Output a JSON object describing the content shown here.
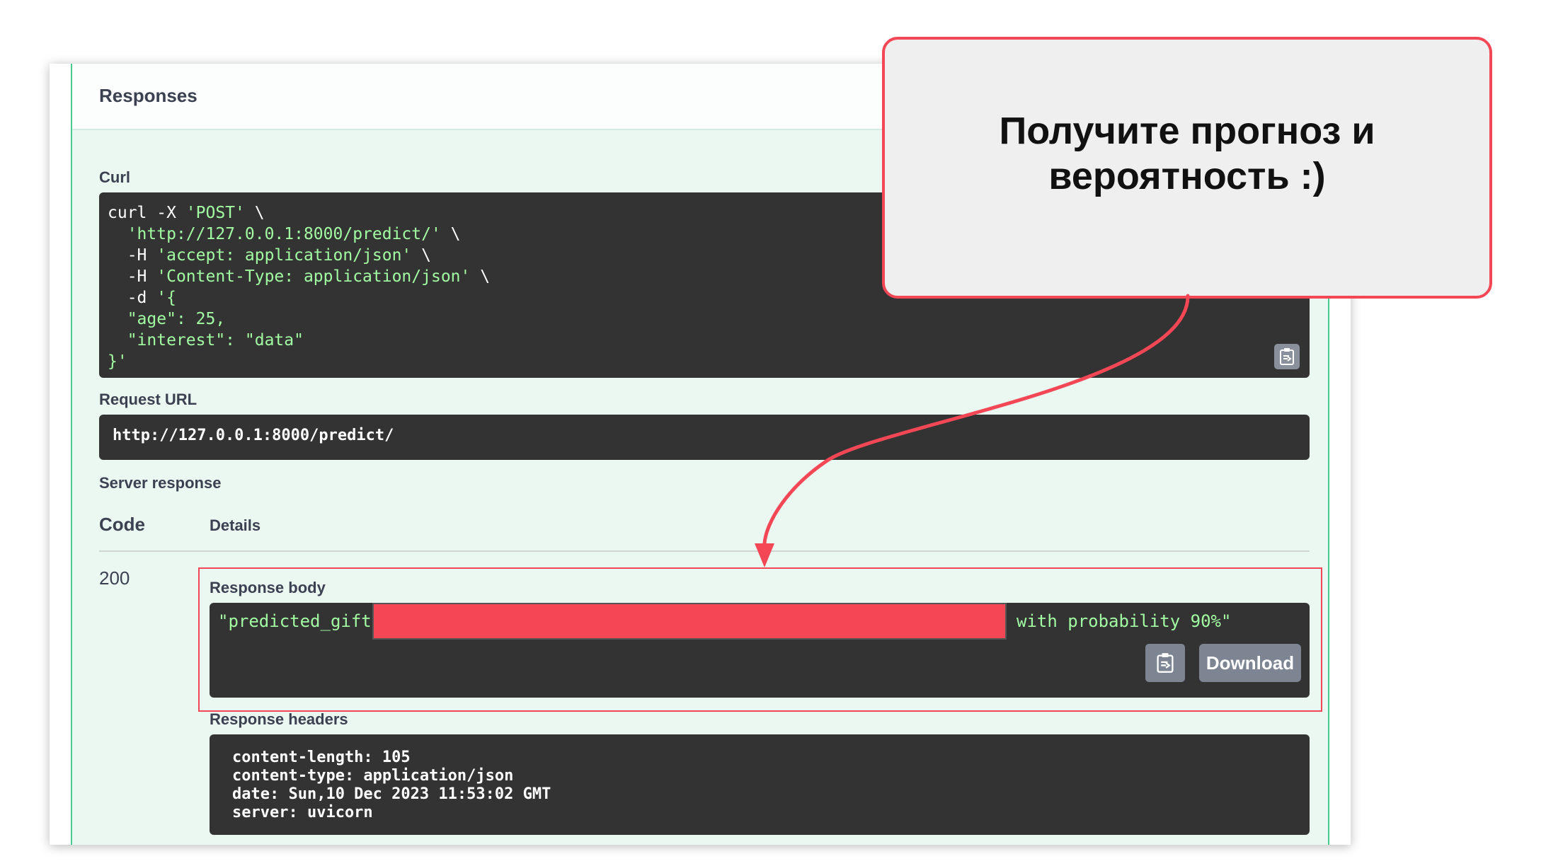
{
  "responses_title": "Responses",
  "curl": {
    "label": "Curl",
    "line1_cmd": "curl -X ",
    "line1_str": "'POST'",
    "line1_tail": " \\",
    "line2_str": "'http://127.0.0.1:8000/predict/'",
    "line2_tail": " \\",
    "line3_cmd": "-H ",
    "line3_str": "'accept: application/json'",
    "line3_tail": " \\",
    "line4_cmd": "-H ",
    "line4_str": "'Content-Type: application/json'",
    "line4_tail": " \\",
    "line5_cmd": "-d ",
    "line5_str": "'{",
    "line6_str": "\"age\": 25,",
    "line7_str": "\"interest\": \"data\"",
    "line8_str": "}'"
  },
  "request_url": {
    "label": "Request URL",
    "value": "http://127.0.0.1:8000/predict/"
  },
  "server_response": {
    "label": "Server response",
    "code_header": "Code",
    "details_header": "Details",
    "code": "200",
    "response_body_label": "Response body",
    "body_prefix": "\"predicted_gift:",
    "body_suffix": "with probability 90%\"",
    "download_label": "Download",
    "response_headers_label": "Response headers",
    "headers": [
      "content-length: 105",
      "content-type: application/json",
      "date: Sun,10 Dec 2023 11:53:02 GMT",
      "server: uvicorn"
    ]
  },
  "callout": {
    "line1": "Получите прогноз и",
    "line2": "вероятность :)"
  },
  "colors": {
    "accent_red": "#f44756",
    "code_bg": "#333333",
    "string_green": "#a2fca2",
    "panel_bg": "#ebf7f1"
  },
  "icons": [
    "clipboard-icon",
    "arrow"
  ]
}
